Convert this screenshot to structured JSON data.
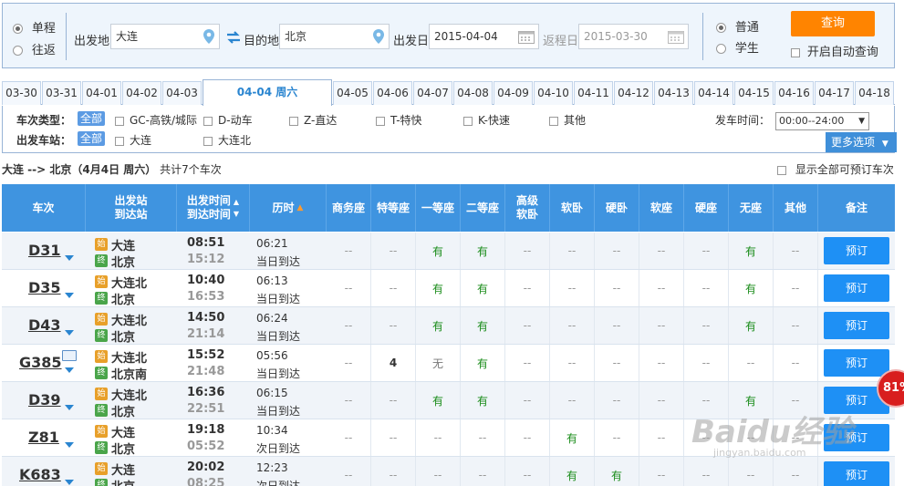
{
  "search": {
    "trip_type": {
      "oneway": "单程",
      "roundtrip": "往返"
    },
    "from_label": "出发地",
    "from_value": "大连",
    "to_label": "目的地",
    "to_value": "北京",
    "depart_label": "出发日",
    "depart_value": "2015-04-04",
    "return_label": "返程日",
    "return_value": "2015-03-30",
    "ticket_type": {
      "normal": "普通",
      "student": "学生"
    },
    "query_button": "查询",
    "auto_query_label": "开启自动查询"
  },
  "date_tabs": [
    "03-30",
    "03-31",
    "04-01",
    "04-02",
    "04-03",
    "04-04 周六",
    "04-05",
    "04-06",
    "04-07",
    "04-08",
    "04-09",
    "04-10",
    "04-11",
    "04-12",
    "04-13",
    "04-14",
    "04-15",
    "04-16",
    "04-17",
    "04-18"
  ],
  "active_tab": "04-04 周六",
  "filters": {
    "type_label": "车次类型：",
    "station_label": "出发车站：",
    "all_label": "全部",
    "types": [
      "GC-高铁/城际",
      "D-动车",
      "Z-直达",
      "T-特快",
      "K-快速",
      "其他"
    ],
    "stations": [
      "大连",
      "大连北"
    ],
    "time_label": "发车时间：",
    "time_value": "00:00--24:00",
    "more_options": "更多选项"
  },
  "summary": {
    "route": "大连 --> 北京（4月4日  周六）",
    "count": "共计7个车次",
    "show_all": "显示全部可预订车次"
  },
  "table": {
    "headers": {
      "train": "车次",
      "stations_1": "出发站",
      "stations_2": "到达站",
      "times_1": "出发时间",
      "times_2": "到达时间",
      "duration": "历时",
      "business": "商务座",
      "special": "特等座",
      "first": "一等座",
      "second": "二等座",
      "adv_soft_1": "高级",
      "adv_soft_2": "软卧",
      "soft_sleeper": "软卧",
      "hard_sleeper": "硬卧",
      "soft_seat": "软座",
      "hard_seat": "硬座",
      "no_seat": "无座",
      "other": "其他",
      "remark": "备注"
    },
    "rows": [
      {
        "train": "D31",
        "from": "大连",
        "to": "北京",
        "dep": "08:51",
        "arr": "15:12",
        "dur": "06:21",
        "note": "当日到达",
        "seats": [
          "--",
          "--",
          "有",
          "有",
          "--",
          "--",
          "--",
          "--",
          "--",
          "有",
          "--"
        ],
        "book": "预订"
      },
      {
        "train": "D35",
        "from": "大连北",
        "to": "北京",
        "dep": "10:40",
        "arr": "16:53",
        "dur": "06:13",
        "note": "当日到达",
        "seats": [
          "--",
          "--",
          "有",
          "有",
          "--",
          "--",
          "--",
          "--",
          "--",
          "有",
          "--"
        ],
        "book": "预订"
      },
      {
        "train": "D43",
        "from": "大连北",
        "to": "北京",
        "dep": "14:50",
        "arr": "21:14",
        "dur": "06:24",
        "note": "当日到达",
        "seats": [
          "--",
          "--",
          "有",
          "有",
          "--",
          "--",
          "--",
          "--",
          "--",
          "有",
          "--"
        ],
        "book": "预订"
      },
      {
        "train": "G385",
        "from": "大连北",
        "to": "北京南",
        "dep": "15:52",
        "arr": "21:48",
        "dur": "05:56",
        "note": "当日到达",
        "seats": [
          "--",
          "4",
          "无",
          "有",
          "--",
          "--",
          "--",
          "--",
          "--",
          "--",
          "--"
        ],
        "book": "预订"
      },
      {
        "train": "D39",
        "from": "大连北",
        "to": "北京",
        "dep": "16:36",
        "arr": "22:51",
        "dur": "06:15",
        "note": "当日到达",
        "seats": [
          "--",
          "--",
          "有",
          "有",
          "--",
          "--",
          "--",
          "--",
          "--",
          "有",
          "--"
        ],
        "book": "预订"
      },
      {
        "train": "Z81",
        "from": "大连",
        "to": "北京",
        "dep": "19:18",
        "arr": "05:52",
        "dur": "10:34",
        "note": "次日到达",
        "seats": [
          "--",
          "--",
          "--",
          "--",
          "--",
          "有",
          "--",
          "--",
          "--",
          "--",
          "--"
        ],
        "book": "预订"
      },
      {
        "train": "K683",
        "from": "大连",
        "to": "北京",
        "dep": "20:02",
        "arr": "08:25",
        "dur": "12:23",
        "note": "次日到达",
        "seats": [
          "--",
          "--",
          "--",
          "--",
          "--",
          "有",
          "有",
          "--",
          "--",
          "--",
          "--"
        ],
        "book": "预订"
      }
    ]
  },
  "overlays": {
    "percent_badge": "81%",
    "watermark_main": "Baidu经验",
    "watermark_sub": "jingyan.baidu.com"
  },
  "icon_text": {
    "start": "始",
    "end": "终"
  }
}
